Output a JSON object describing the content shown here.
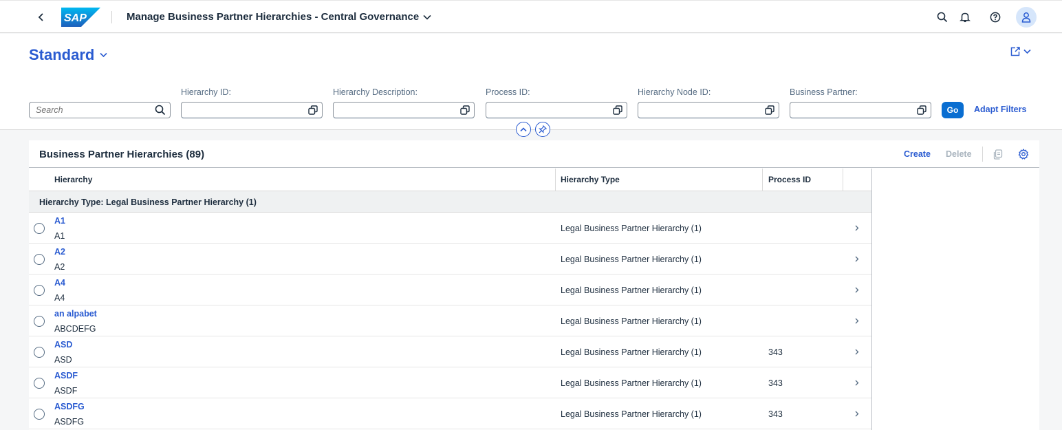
{
  "shell": {
    "logo_text": "SAP",
    "app_title": "Manage Business Partner Hierarchies - Central Governance",
    "icons": [
      "back-icon",
      "search-icon",
      "bell-icon",
      "help-icon",
      "user-icon"
    ]
  },
  "header": {
    "variant": "Standard",
    "search_placeholder": "Search",
    "filters": [
      {
        "label": "Hierarchy ID:"
      },
      {
        "label": "Hierarchy Description:"
      },
      {
        "label": "Process ID:"
      },
      {
        "label": "Hierarchy Node ID:"
      },
      {
        "label": "Business Partner:"
      }
    ],
    "go_label": "Go",
    "adapt_label": "Adapt Filters"
  },
  "table": {
    "title": "Business Partner Hierarchies (89)",
    "create_label": "Create",
    "delete_label": "Delete",
    "columns": [
      "Hierarchy",
      "Hierarchy Type",
      "Process ID"
    ],
    "group_label": "Hierarchy Type: Legal Business Partner Hierarchy (1)",
    "rows": [
      {
        "name": "A1",
        "desc": "A1",
        "type": "Legal Business Partner Hierarchy (1)",
        "process_id": ""
      },
      {
        "name": "A2",
        "desc": "A2",
        "type": "Legal Business Partner Hierarchy (1)",
        "process_id": ""
      },
      {
        "name": "A4",
        "desc": "A4",
        "type": "Legal Business Partner Hierarchy (1)",
        "process_id": ""
      },
      {
        "name": "an alpabet",
        "desc": "ABCDEFG",
        "type": "Legal Business Partner Hierarchy (1)",
        "process_id": ""
      },
      {
        "name": "ASD",
        "desc": "ASD",
        "type": "Legal Business Partner Hierarchy (1)",
        "process_id": "343"
      },
      {
        "name": "ASDF",
        "desc": "ASDF",
        "type": "Legal Business Partner Hierarchy (1)",
        "process_id": "343"
      },
      {
        "name": "ASDFG",
        "desc": "ASDFG",
        "type": "Legal Business Partner Hierarchy (1)",
        "process_id": "343"
      }
    ]
  },
  "colors": {
    "accent": "#2a5bd1",
    "go_button": "#0a6ed1",
    "group_row_bg": "#eff1f2",
    "avatar_bg": "#d6e6fb"
  }
}
